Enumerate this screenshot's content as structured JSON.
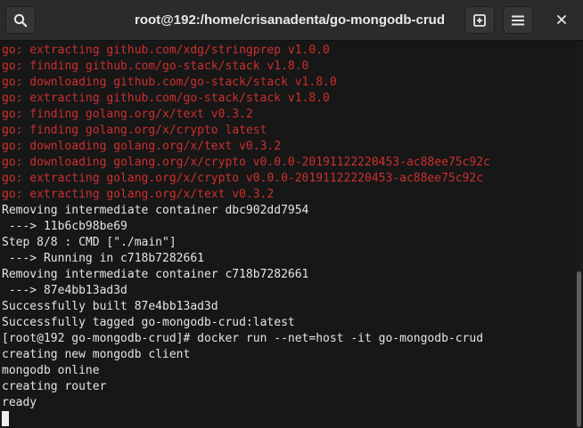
{
  "window": {
    "title": "root@192:/home/crisanadenta/go-mongodb-crud"
  },
  "header": {
    "icons": [
      "search-icon",
      "new-tab-icon",
      "hamburger-menu-icon",
      "close-icon"
    ]
  },
  "colors": {
    "titlebar_bg": "#2b2b2b",
    "terminal_bg": "#171717",
    "text": "#e4e4e4",
    "error_text": "#cc2f2f"
  },
  "terminal": {
    "lines": [
      {
        "text": "go: extracting github.com/xdg/stringprep v1.0.0",
        "kind": "err"
      },
      {
        "text": "go: finding github.com/go-stack/stack v1.8.0",
        "kind": "err"
      },
      {
        "text": "go: downloading github.com/go-stack/stack v1.8.0",
        "kind": "err"
      },
      {
        "text": "go: extracting github.com/go-stack/stack v1.8.0",
        "kind": "err"
      },
      {
        "text": "go: finding golang.org/x/text v0.3.2",
        "kind": "err"
      },
      {
        "text": "go: finding golang.org/x/crypto latest",
        "kind": "err"
      },
      {
        "text": "go: downloading golang.org/x/text v0.3.2",
        "kind": "err"
      },
      {
        "text": "go: downloading golang.org/x/crypto v0.0.0-20191122220453-ac88ee75c92c",
        "kind": "err"
      },
      {
        "text": "go: extracting golang.org/x/crypto v0.0.0-20191122220453-ac88ee75c92c",
        "kind": "err"
      },
      {
        "text": "go: extracting golang.org/x/text v0.3.2",
        "kind": "err"
      },
      {
        "text": "Removing intermediate container dbc902dd7954",
        "kind": "out"
      },
      {
        "text": " ---> 11b6cb98be69",
        "kind": "out"
      },
      {
        "text": "Step 8/8 : CMD [\"./main\"]",
        "kind": "out"
      },
      {
        "text": " ---> Running in c718b7282661",
        "kind": "out"
      },
      {
        "text": "Removing intermediate container c718b7282661",
        "kind": "out"
      },
      {
        "text": " ---> 87e4bb13ad3d",
        "kind": "out"
      },
      {
        "text": "Successfully built 87e4bb13ad3d",
        "kind": "out"
      },
      {
        "text": "Successfully tagged go-mongodb-crud:latest",
        "kind": "out"
      },
      {
        "text": "[root@192 go-mongodb-crud]# docker run --net=host -it go-mongodb-crud",
        "kind": "out"
      },
      {
        "text": "creating new mongodb client",
        "kind": "out"
      },
      {
        "text": "mongodb online",
        "kind": "out"
      },
      {
        "text": "creating router",
        "kind": "out"
      },
      {
        "text": "ready",
        "kind": "out"
      }
    ]
  }
}
